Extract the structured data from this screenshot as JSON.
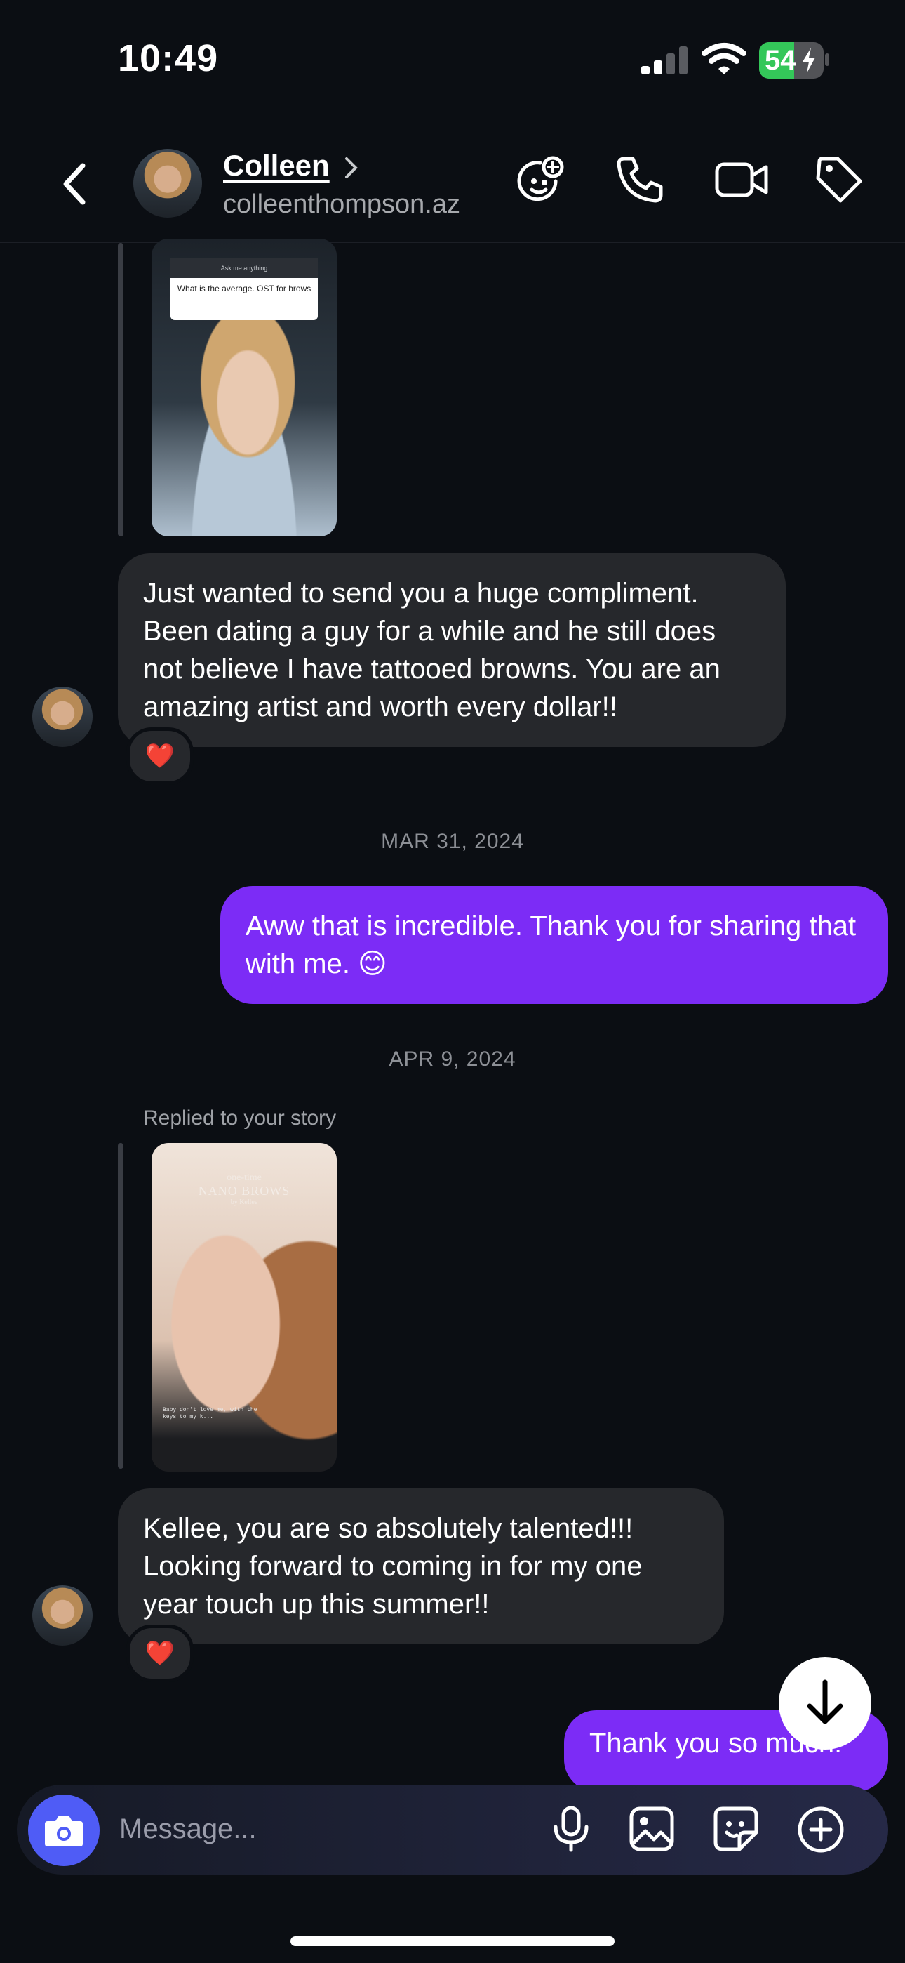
{
  "status_bar": {
    "time": "10:49",
    "battery": "54"
  },
  "header": {
    "name": "Colleen",
    "username": "colleenthompson.az"
  },
  "story1": {
    "header": "Ask me anything",
    "question": "What is the average. OST for brows"
  },
  "messages": {
    "m1": "Just wanted to send you a huge compliment. Been dating a guy for a while and he still does not believe I have tattooed browns. You are an amazing artist and worth every dollar!!",
    "m1_reaction": "❤️",
    "date1": "MAR 31, 2024",
    "m2": "Aww that is incredible. Thank you for sharing that with me. 😊",
    "date2": "APR 9, 2024",
    "replied_label": "Replied to your story",
    "m3": "Kellee, you are so absolutely talented!!! Looking forward to coming in for my one year touch up this summer!!",
    "m3_reaction": "❤️",
    "m4": "Thank you so much!"
  },
  "story2": {
    "line1": "one-time",
    "line2": "NANO BROWS",
    "line3": "by Kellee",
    "bottom": "Baby don't love me, with the keys to my k..."
  },
  "composer": {
    "placeholder": "Message..."
  }
}
